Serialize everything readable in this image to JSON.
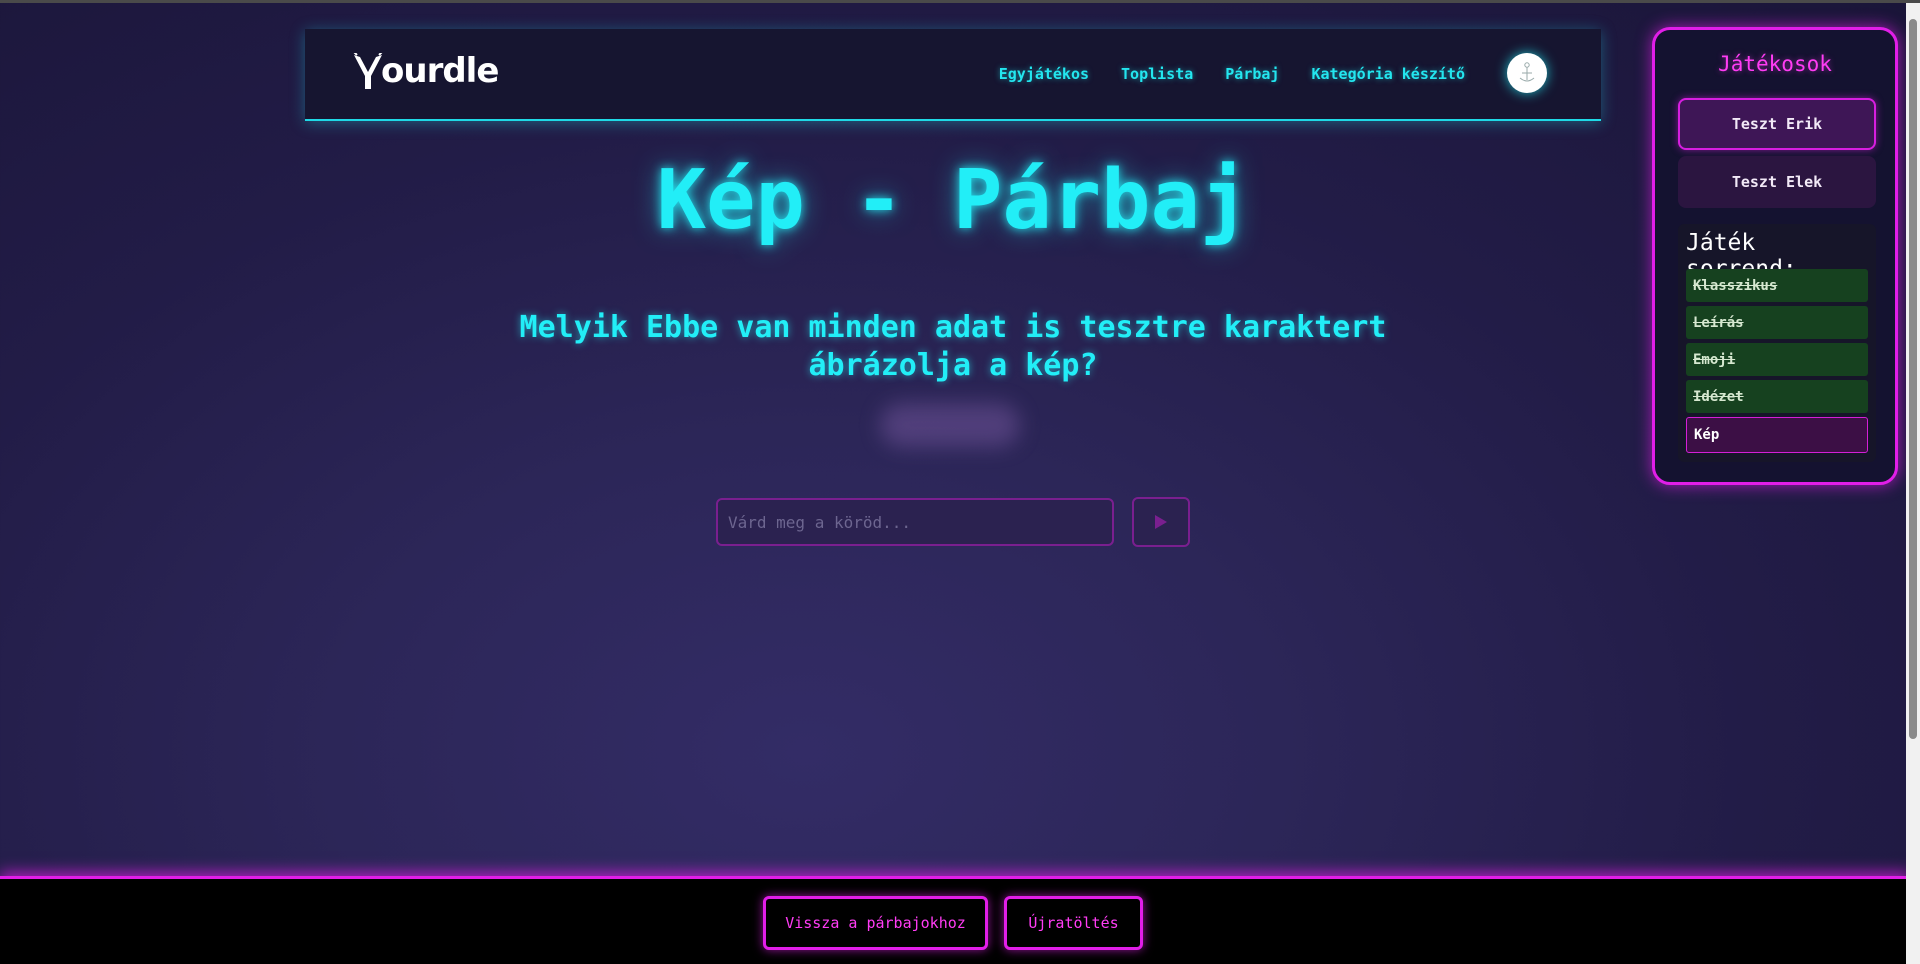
{
  "header": {
    "logo_text": "ourdle",
    "nav": [
      {
        "label": "Egyjátékos"
      },
      {
        "label": "Toplista"
      },
      {
        "label": "Párbaj"
      },
      {
        "label": "Kategória készítő"
      }
    ]
  },
  "main": {
    "title": "Kép - Párbaj",
    "question": "Melyik Ebbe van minden adat is tesztre karaktert ábrázolja a kép?",
    "input_placeholder": "Várd meg a köröd..."
  },
  "players_panel": {
    "title": "Játékosok",
    "players": [
      {
        "name": "Teszt Erik",
        "active": true
      },
      {
        "name": "Teszt Elek",
        "active": false
      }
    ],
    "order_title": "Játék sorrend:",
    "order": [
      {
        "label": "Klasszikus",
        "status": "done"
      },
      {
        "label": "Leírás",
        "status": "done"
      },
      {
        "label": "Emoji",
        "status": "done"
      },
      {
        "label": "Idézet",
        "status": "done"
      },
      {
        "label": "Kép",
        "status": "current"
      }
    ]
  },
  "footer": {
    "back_label": "Vissza a párbajokhoz",
    "reload_label": "Újratöltés"
  },
  "colors": {
    "neon_cyan": "#22eef7",
    "neon_magenta": "#e11ee8",
    "done_green": "#16411f",
    "background": "#2c2658"
  },
  "icons": {
    "submit": "play-triangle-icon",
    "logo": "y-antler-logo-icon"
  }
}
